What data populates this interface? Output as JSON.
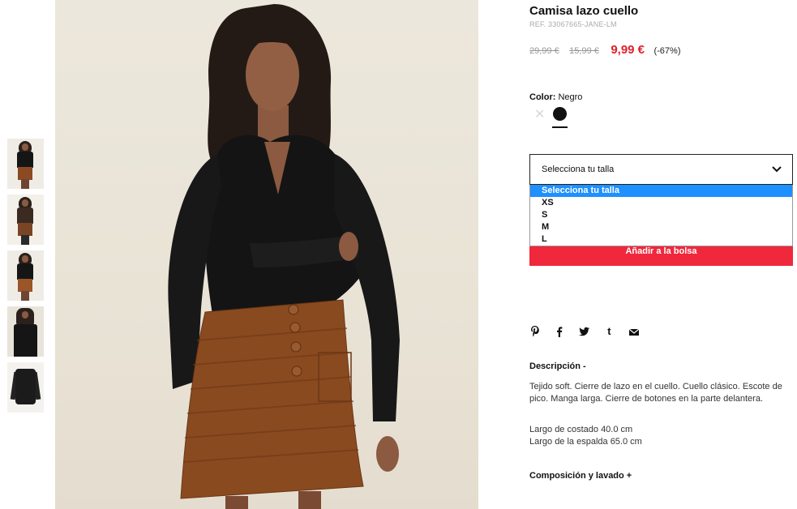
{
  "product": {
    "title": "Camisa lazo cuello",
    "ref": "REF. 33067665-JANE-LM",
    "prices": {
      "original": "29,99 €",
      "previous": "15,99 €",
      "current": "9,99 €",
      "discount": "(-67%)"
    }
  },
  "color": {
    "label": "Color:",
    "value": "Negro",
    "swatches": [
      "unavailable-cross-icon",
      "black-swatch"
    ]
  },
  "size_select": {
    "selected": "Selecciona tu talla",
    "options": [
      "Selecciona tu talla",
      "XS",
      "S",
      "M",
      "L"
    ]
  },
  "add_button": "Añadir a la bolsa",
  "social": [
    "pinterest-icon",
    "facebook-icon",
    "twitter-icon",
    "tumblr-icon",
    "email-icon"
  ],
  "description": {
    "title": "Descripción -",
    "text": "Tejido soft. Cierre de lazo en el cuello. Cuello clásico. Escote de pico. Manga larga. Cierre de botones en la parte delantera.",
    "length_front": "Largo de costado 40.0 cm",
    "length_back": "Largo de la espalda 65.0 cm"
  },
  "composition": "Composición y lavado +",
  "colors": {
    "accent_red": "#f0283c",
    "price_red": "#e0202b",
    "dropdown_highlight": "#1e90ff"
  }
}
